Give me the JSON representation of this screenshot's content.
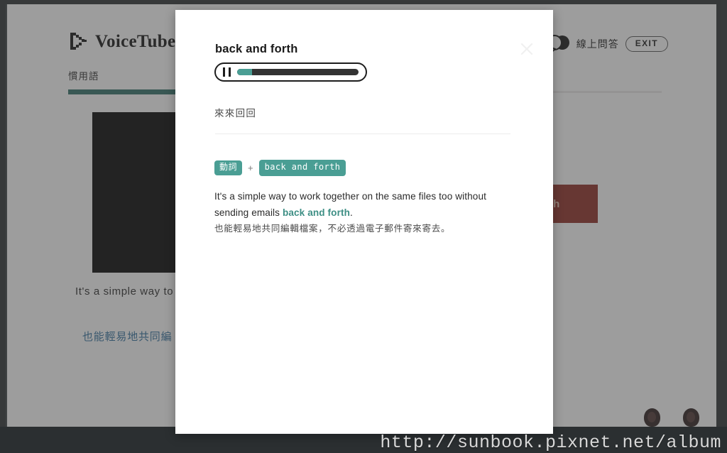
{
  "background": {
    "brand": {
      "logo_text": "VoiceTube",
      "logo_icon": "play-pixel-icon"
    },
    "header": {
      "qa_label": "線上問答",
      "qa_icon": "speech-bubbles-icon",
      "exit_label": "EXIT"
    },
    "tabs": [
      {
        "label": "慣用語",
        "active": true
      }
    ],
    "content": {
      "caption_en": "It's a simple way to             too without sending",
      "caption_zh": "也能輕易地共同編",
      "red_button_label": "h"
    }
  },
  "modal": {
    "title": "back and forth",
    "close_icon": "close-icon",
    "player": {
      "state_icon": "pause-icon",
      "progress_percent": 12
    },
    "definition_zh": "來來回回",
    "tags": {
      "part_of_speech": "動詞",
      "plus": "+",
      "phrase": "back and forth"
    },
    "example": {
      "en_before": "It's a simple way to work together on the same files too without sending emails ",
      "en_highlight": "back and forth",
      "en_after": ".",
      "zh": "也能輕易地共同編輯檔案，不必透過電子郵件寄來寄去。"
    }
  },
  "watermark": {
    "url": "http://sunbook.pixnet.net/album"
  }
}
